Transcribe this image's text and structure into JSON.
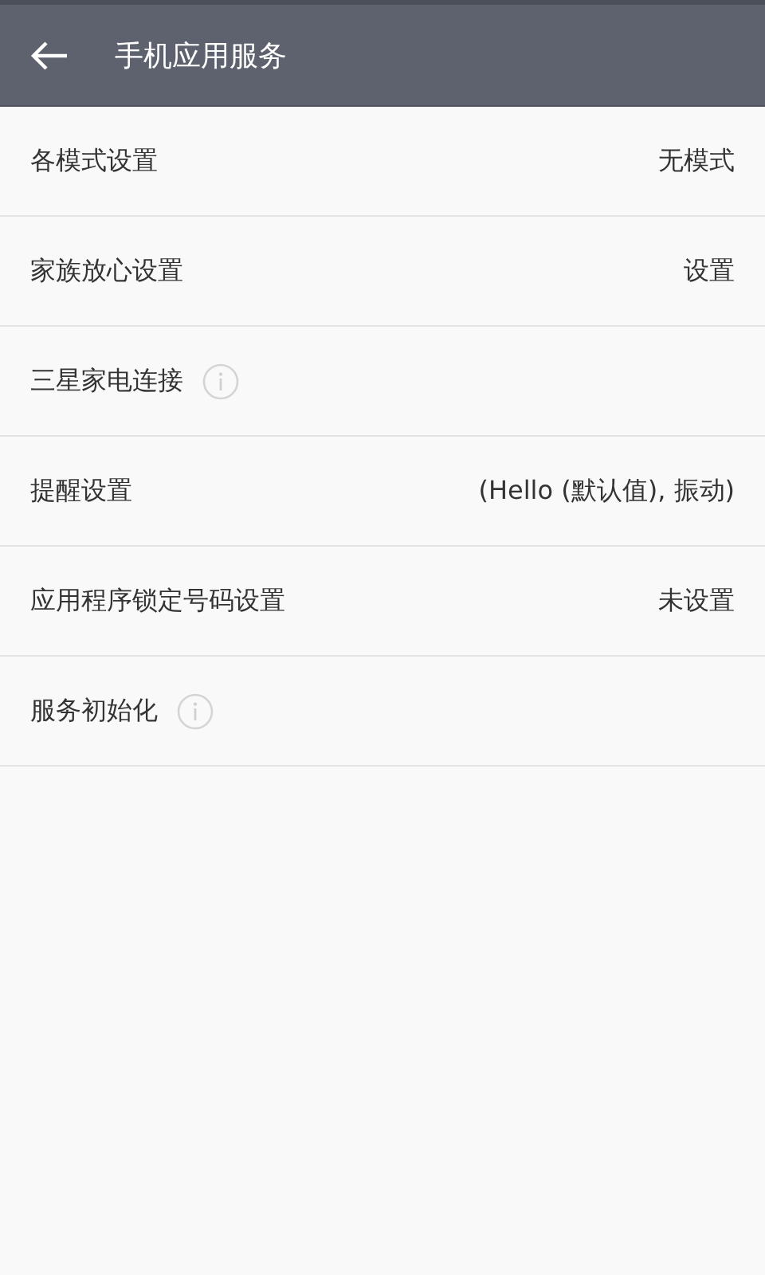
{
  "header": {
    "title": "手机应用服务"
  },
  "items": [
    {
      "label": "各模式设置",
      "value": "无模式",
      "info": false
    },
    {
      "label": "家族放心设置",
      "value": "设置",
      "info": false
    },
    {
      "label": "三星家电连接",
      "info": true
    },
    {
      "label": "提醒设置",
      "value": "(Hello (默认值), 振动)",
      "info": false
    },
    {
      "label": "应用程序锁定号码设置",
      "value": "未设置",
      "info": false
    },
    {
      "label": "服务初始化",
      "info": true
    }
  ]
}
